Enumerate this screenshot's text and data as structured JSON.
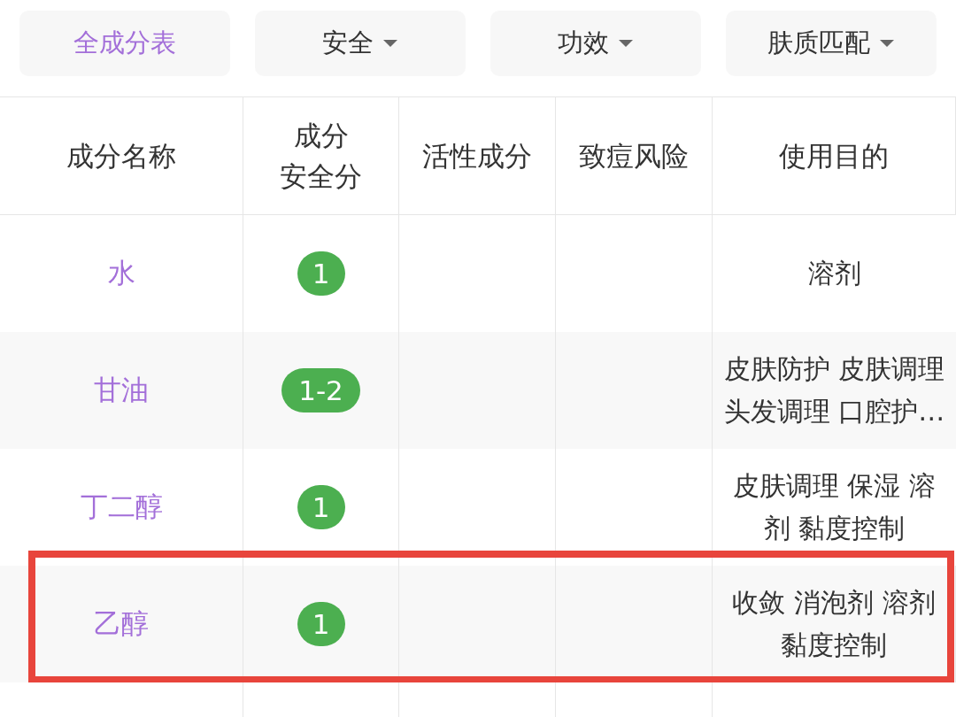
{
  "filters": [
    {
      "label": "全成分表",
      "selected": true,
      "dropdown": false
    },
    {
      "label": "安全",
      "selected": false,
      "dropdown": true
    },
    {
      "label": "功效",
      "selected": false,
      "dropdown": true
    },
    {
      "label": "肤质匹配",
      "selected": false,
      "dropdown": true
    }
  ],
  "table": {
    "columns": [
      [
        "成分名称"
      ],
      [
        "成分",
        "安全分"
      ],
      [
        "活性成分"
      ],
      [
        "致痘风险"
      ],
      [
        "使用目的"
      ]
    ],
    "rows": [
      {
        "name": "水",
        "score": "1",
        "purpose": [
          "溶剂"
        ],
        "highlighted": false
      },
      {
        "name": "甘油",
        "score": "1-2",
        "purpose": [
          "皮肤防护 皮肤调理",
          "头发调理 口腔护…"
        ],
        "highlighted": false
      },
      {
        "name": "丁二醇",
        "score": "1",
        "purpose": [
          "皮肤调理 保湿 溶",
          "剂 黏度控制"
        ],
        "highlighted": false
      },
      {
        "name": "乙醇",
        "score": "1",
        "purpose": [
          "收敛 消泡剂 溶剂",
          "黏度控制"
        ],
        "highlighted": true
      }
    ]
  }
}
